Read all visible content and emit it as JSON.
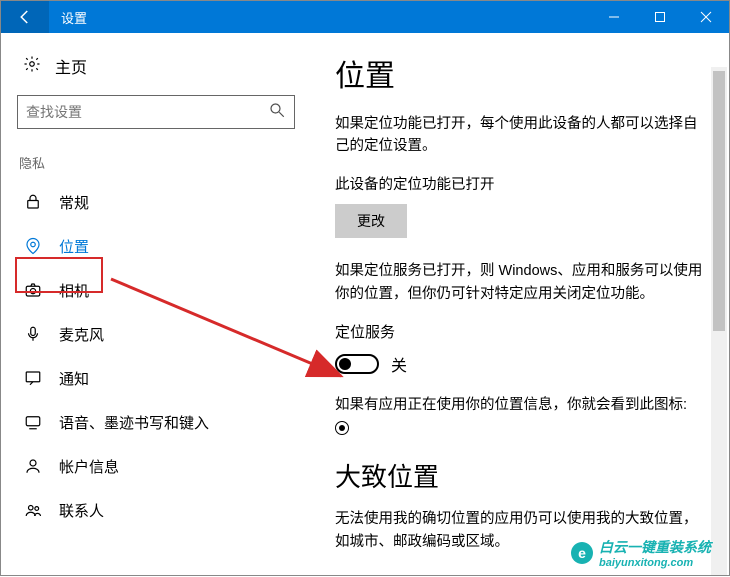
{
  "titlebar": {
    "title": "设置"
  },
  "sidebar": {
    "home_label": "主页",
    "search_placeholder": "查找设置",
    "group_label": "隐私",
    "items": [
      {
        "label": "常规"
      },
      {
        "label": "位置"
      },
      {
        "label": "相机"
      },
      {
        "label": "麦克风"
      },
      {
        "label": "通知"
      },
      {
        "label": "语音、墨迹书写和键入"
      },
      {
        "label": "帐户信息"
      },
      {
        "label": "联系人"
      }
    ]
  },
  "main": {
    "heading": "位置",
    "intro": "如果定位功能已打开，每个使用此设备的人都可以选择自己的定位设置。",
    "device_status": "此设备的定位功能已打开",
    "change_btn": "更改",
    "service_note": "如果定位服务已打开，则 Windows、应用和服务可以使用你的位置，但你仍可针对特定应用关闭定位功能。",
    "service_label": "定位服务",
    "toggle_state": "关",
    "inuse_text": "如果有应用正在使用你的位置信息，你就会看到此图标:",
    "section2_heading": "大致位置",
    "section2_text": "无法使用我的确切位置的应用仍可以使用我的大致位置，如城市、邮政编码或区域。"
  },
  "watermark": {
    "logo_letter": "e",
    "text": "白云一键重装系统",
    "url": "baiyunxitong.com"
  }
}
